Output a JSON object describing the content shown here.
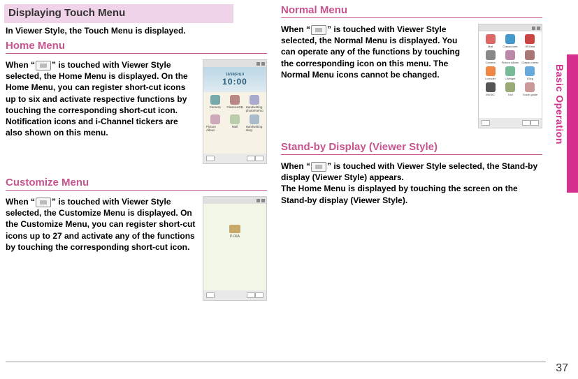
{
  "side_label": "Basic Operation",
  "page_number": "37",
  "banner_title": " Displaying Touch Menu",
  "intro_line": "In Viewer Style, the Touch Menu is displayed.",
  "home": {
    "heading": "Home Menu",
    "pre": "When “",
    "post": "” is touched with Viewer Style selected, the Home Menu is displayed. On the Home Menu, you can register short-cut icons up to six and activate respective functions by touching the corresponding short-cut icon. Notification icons and i-Channel tickers are also shown on this menu.",
    "screen": {
      "date": "10/10(Fri) 0",
      "time": "10:00",
      "apps": [
        "Camera",
        "ClassiceDB",
        "Handwriting photo/memo",
        "Picture Album",
        "Mail",
        "Handwriting diary"
      ]
    }
  },
  "customize": {
    "heading": "Customize Menu",
    "pre": "When “",
    "post": "” is touched with Viewer Style selected, the Customize Menu is displayed. On the Customize Menu, you can register short-cut icons up to 27 and activate any of the functions by touching the corresponding short-cut icon.",
    "folder_label": "P-06A"
  },
  "normal": {
    "heading": "Normal Menu",
    "pre": "When “",
    "post": "” is touched with Viewer Style selected, the Normal Menu is displayed. You can operate any of the functions by touching the corresponding icon on this menu. The Normal Menu icons cannot be changed.",
    "apps": [
      "Mail",
      "Classic/web",
      "IR/Data",
      "Camera",
      "Picture Album",
      "Classic menu",
      "i-concier",
      "i-Widget",
      "1Seg",
      "MUSIC",
      "Tool",
      "Touch guide"
    ]
  },
  "standby": {
    "heading": "Stand-by Display (Viewer Style)",
    "pre": "When “",
    "post1": "” is touched with Viewer Style selected, the Stand-by display (Viewer Style) appears.",
    "line2": "The Home Menu is displayed by touching the screen on the Stand-by display (Viewer Style)."
  }
}
